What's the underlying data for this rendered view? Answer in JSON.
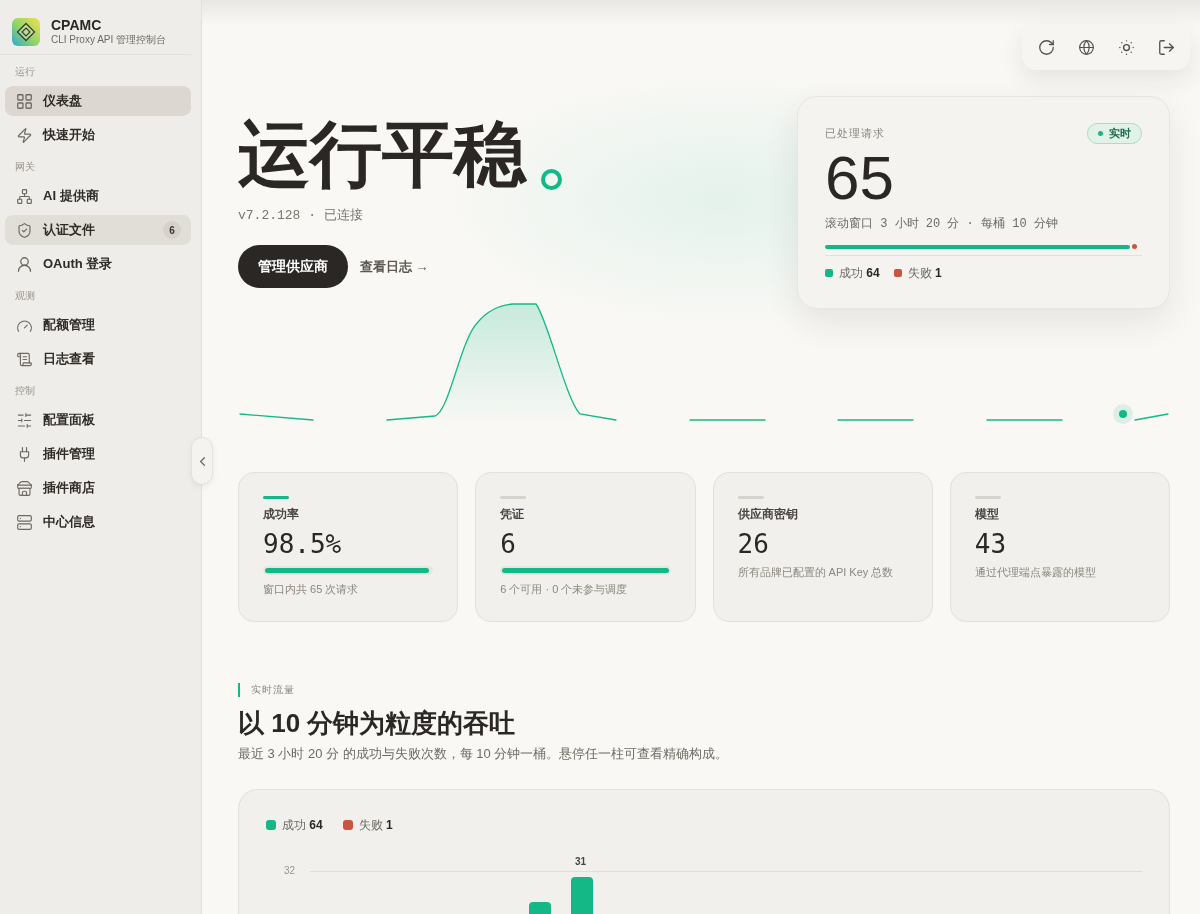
{
  "sidebar": {
    "brand": {
      "title": "CPAMC",
      "subtitle": "CLI Proxy API 管理控制台"
    },
    "sections": [
      {
        "title": "运行",
        "items": [
          {
            "label": "仪表盘",
            "selected": true,
            "hovered": false
          },
          {
            "label": "快速开始",
            "selected": false,
            "hovered": false
          }
        ]
      },
      {
        "title": "网关",
        "items": [
          {
            "label": "AI 提供商",
            "selected": false,
            "hovered": false
          },
          {
            "label": "认证文件",
            "selected": false,
            "hovered": true,
            "badge": "6"
          },
          {
            "label": "OAuth 登录",
            "selected": false,
            "hovered": false
          }
        ]
      },
      {
        "title": "观测",
        "items": [
          {
            "label": "配额管理",
            "selected": false,
            "hovered": false
          },
          {
            "label": "日志查看",
            "selected": false,
            "hovered": false
          }
        ]
      },
      {
        "title": "控制",
        "items": [
          {
            "label": "配置面板",
            "selected": false,
            "hovered": false
          },
          {
            "label": "插件管理",
            "selected": false,
            "hovered": false
          },
          {
            "label": "插件商店",
            "selected": false,
            "hovered": false
          },
          {
            "label": "中心信息",
            "selected": false,
            "hovered": false
          }
        ]
      }
    ]
  },
  "hero": {
    "title": "运行平稳",
    "meta": "v7.2.128 · 已连接",
    "primary_button": "管理供应商",
    "link": "查看日志 →"
  },
  "requests_card": {
    "label": "已处理请求",
    "badge": "实时",
    "count": "65",
    "window": "滚动窗口 3 小时 20 分 · 每桶 10 分钟",
    "level": 0.985,
    "legend": [
      {
        "label": "成功",
        "value": "64",
        "color": "#14b886"
      },
      {
        "label": "失败",
        "value": "1",
        "color": "#c9553f"
      }
    ]
  },
  "stats": [
    {
      "kind": "meter",
      "accent": true,
      "label": "成功率",
      "value": "98.5%",
      "level": 0.985,
      "caption": "窗口内共 65 次请求"
    },
    {
      "kind": "meter",
      "accent": false,
      "label": "凭证",
      "value": "6",
      "level": 1,
      "caption": "6 个可用 · 0 个未参与调度"
    },
    {
      "kind": "plain",
      "accent": false,
      "label": "供应商密钥",
      "value": "26",
      "caption": "所有品牌已配置的 API Key 总数"
    },
    {
      "kind": "plain",
      "accent": false,
      "label": "模型",
      "value": "43",
      "caption": "通过代理端点暴露的模型"
    }
  ],
  "traffic": {
    "eyebrow": "实时流量",
    "title": "以 10 分钟为粒度的吞吐",
    "description": "最近 3 小时 20 分 的成功与失败次数，每 10 分钟一桶。悬停任一柱可查看精确构成。",
    "chart": {
      "legend": [
        {
          "label": "成功",
          "value": "64",
          "color": "#14b886"
        },
        {
          "label": "失败",
          "value": "1",
          "color": "#c9553f"
        }
      ],
      "y_tick": "32",
      "peak_label": "31"
    }
  }
}
